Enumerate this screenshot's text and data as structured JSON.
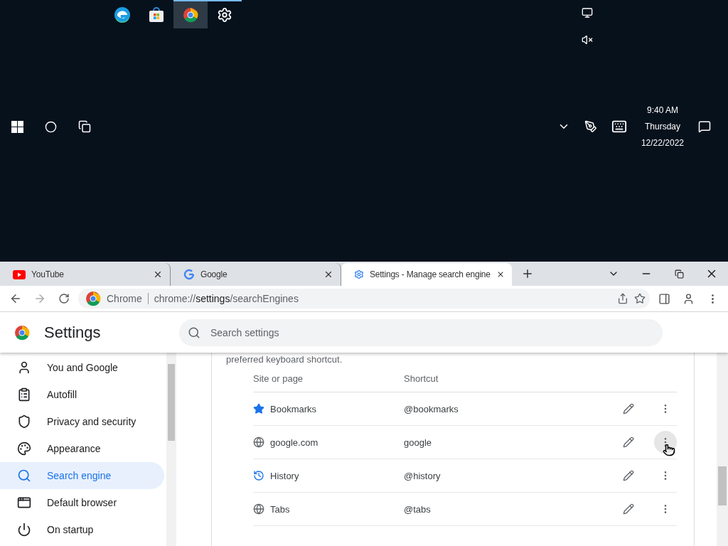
{
  "taskbar": {
    "pinned_apps": [
      {
        "kind": "edge",
        "active": false,
        "running": false
      },
      {
        "kind": "store",
        "active": false,
        "running": false
      },
      {
        "kind": "chrome",
        "active": true,
        "running": true
      },
      {
        "kind": "gear",
        "active": false,
        "running": true
      }
    ],
    "clock": {
      "time": "9:40 AM",
      "day": "Thursday",
      "date": "12/22/2022"
    }
  },
  "browser": {
    "tabs": [
      {
        "title": "YouTube",
        "kind": "youtube",
        "selected": false
      },
      {
        "title": "Google",
        "kind": "google",
        "selected": false
      },
      {
        "title": "Settings - Manage search engine",
        "kind": "settings",
        "selected": true
      }
    ],
    "address": {
      "site": "Chrome",
      "url_prefix": "chrome://",
      "url_host": "settings",
      "url_path": "/searchEngines"
    }
  },
  "settings": {
    "title": "Settings",
    "search": {
      "placeholder": "Search settings"
    },
    "sidebar": [
      {
        "label": "You and Google",
        "kind": "person",
        "selected": false
      },
      {
        "label": "Autofill",
        "kind": "clipboard",
        "selected": false
      },
      {
        "label": "Privacy and security",
        "kind": "shield",
        "selected": false
      },
      {
        "label": "Appearance",
        "kind": "palette",
        "selected": false
      },
      {
        "label": "Search engine",
        "kind": "search",
        "selected": true
      },
      {
        "label": "Default browser",
        "kind": "browser",
        "selected": false
      },
      {
        "label": "On startup",
        "kind": "power",
        "selected": false
      }
    ],
    "intro": "preferred keyboard shortcut.",
    "table": {
      "columns": [
        "Site or page",
        "Shortcut"
      ],
      "rows": [
        {
          "site": "Bookmarks",
          "kind": "star",
          "shortcut": "@bookmarks",
          "hovered": false
        },
        {
          "site": "google.com",
          "kind": "globe",
          "shortcut": "google",
          "hovered": true
        },
        {
          "site": "History",
          "kind": "history",
          "shortcut": "@history",
          "hovered": false
        },
        {
          "site": "Tabs",
          "kind": "globe",
          "shortcut": "@tabs",
          "hovered": false
        }
      ]
    }
  }
}
